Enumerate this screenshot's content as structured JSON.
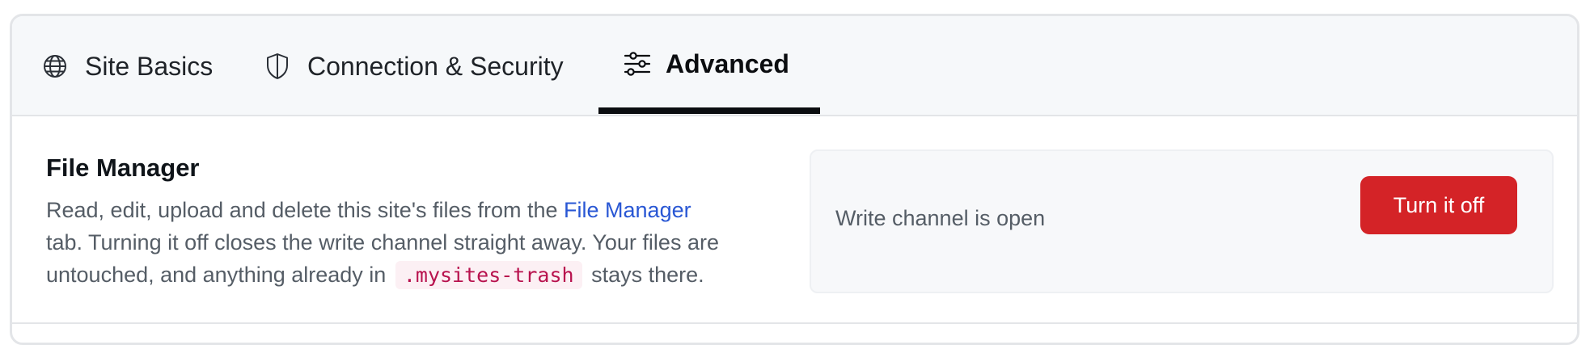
{
  "tabs": {
    "site_basics": {
      "label": "Site Basics",
      "icon": "globe-icon"
    },
    "connection_security": {
      "label": "Connection & Security",
      "icon": "shield-icon"
    },
    "advanced": {
      "label": "Advanced",
      "icon": "sliders-icon",
      "active": true
    }
  },
  "file_manager": {
    "title": "File Manager",
    "description": {
      "line1_prefix": "Read, edit, upload and delete this site's files from the ",
      "link_text": "File Manager",
      "line2": "tab. Turning it off closes the write channel straight away. Your files are",
      "line3_prefix": "untouched, and anything already in",
      "code": ".mysites-trash",
      "line3_suffix": "stays there."
    },
    "status_text": "Write channel is open",
    "button_label": "Turn it off"
  },
  "colors": {
    "accent_link": "#2957d4",
    "danger_button": "#d42327",
    "code_text": "#b8124e"
  }
}
